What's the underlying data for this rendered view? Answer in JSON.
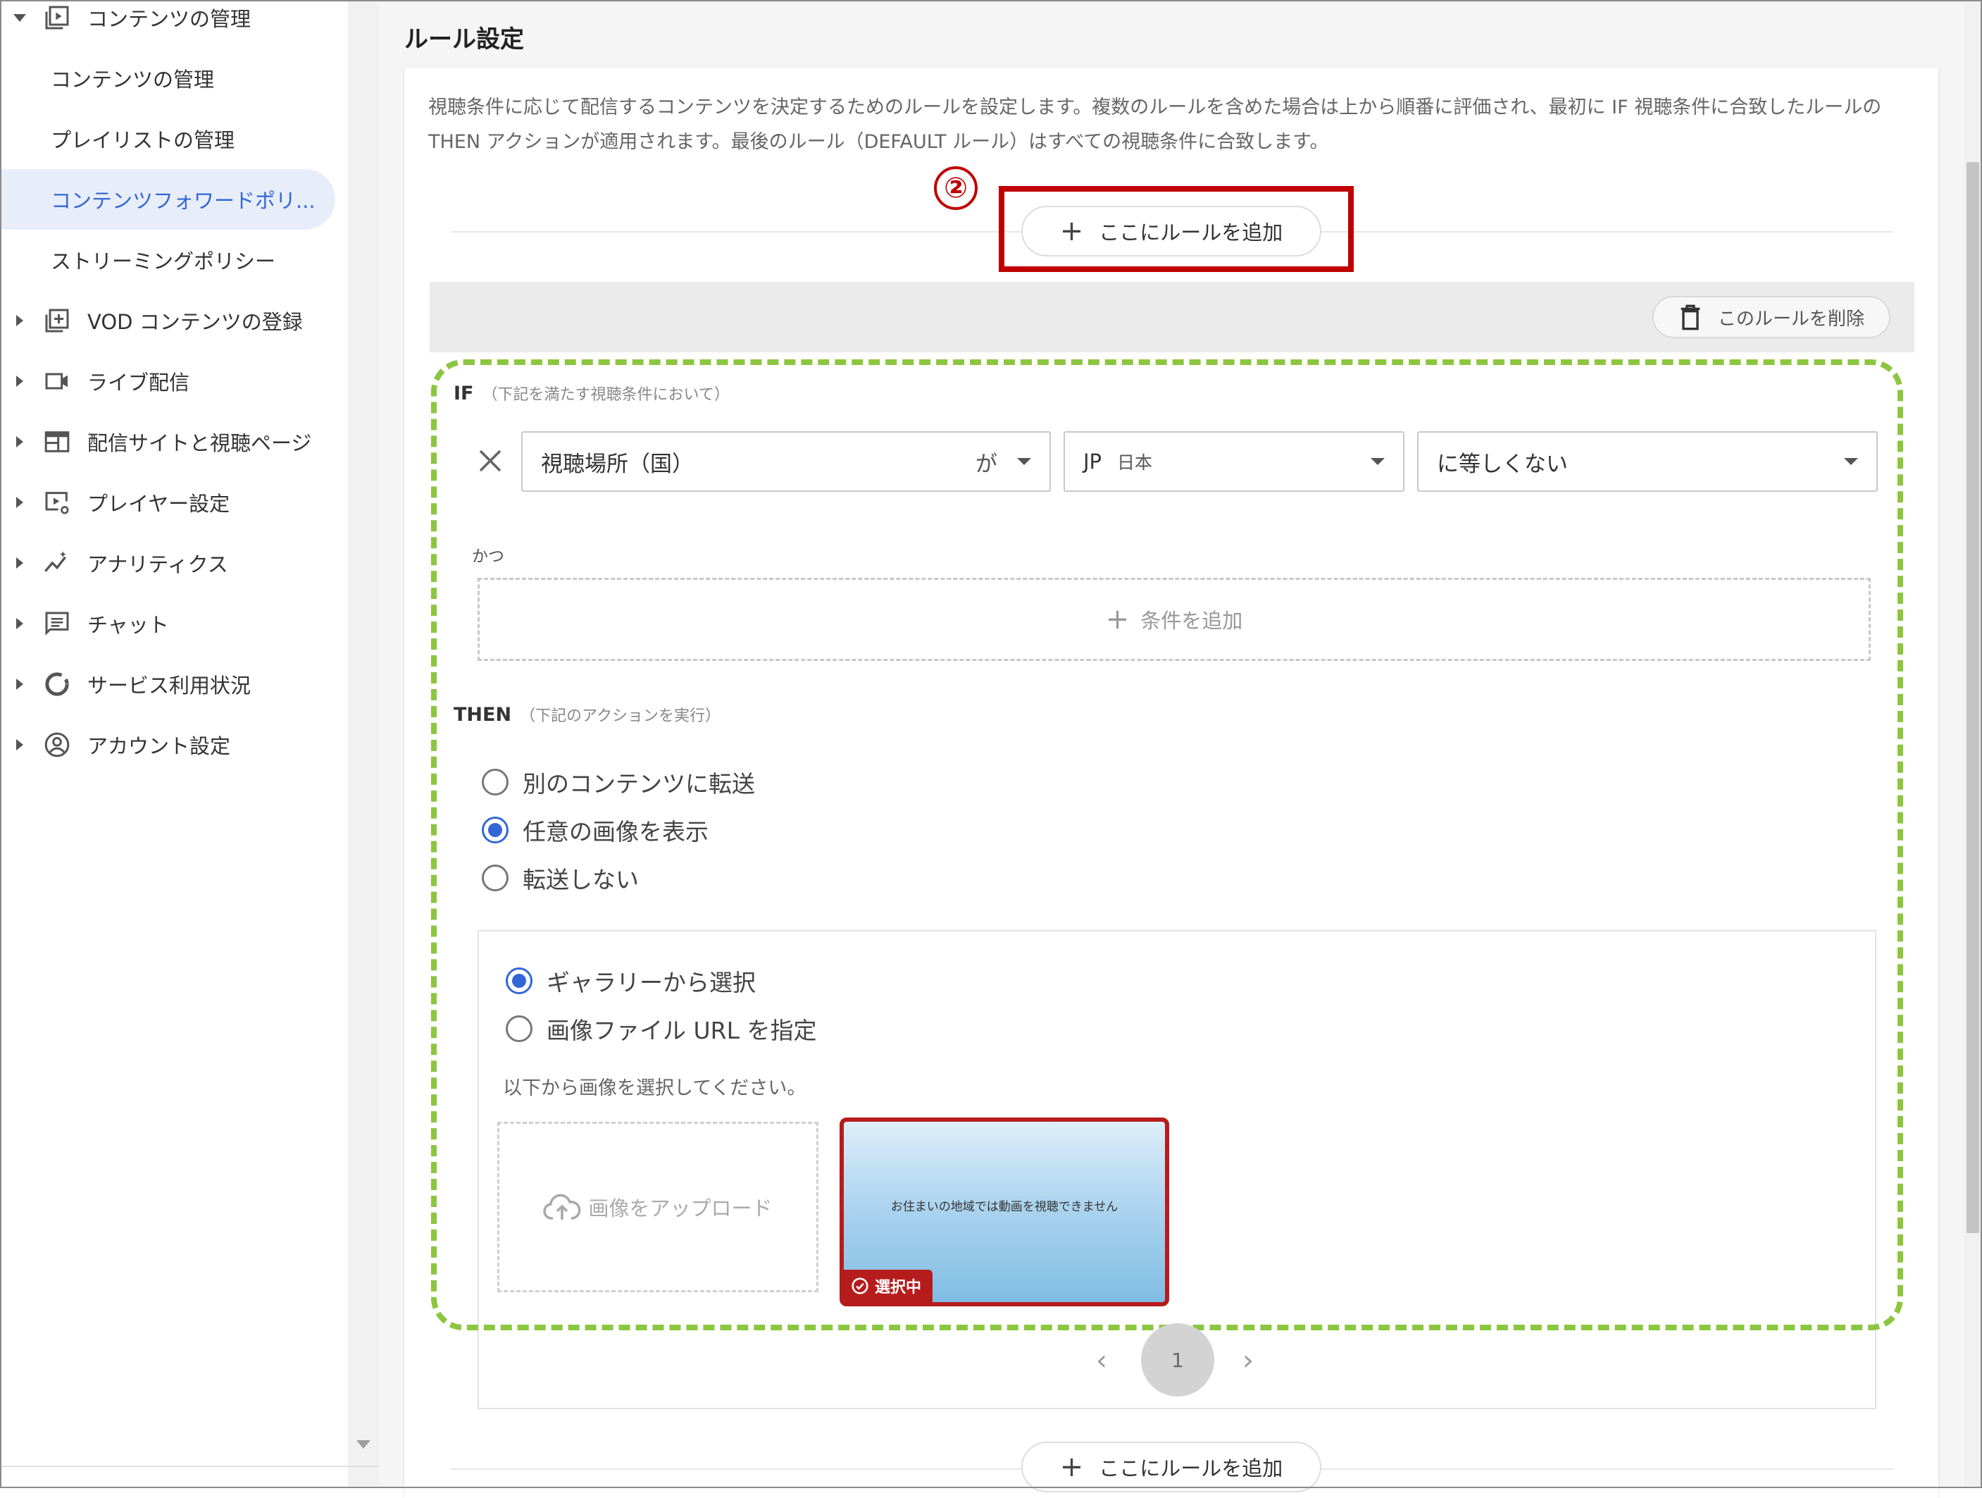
{
  "sidebar": {
    "content_mgmt_parent": "コンテンツの管理",
    "content_mgmt_sub": "コンテンツの管理",
    "playlist_mgmt": "プレイリストの管理",
    "forward_policy": "コンテンツフォワードポリ...",
    "streaming_policy": "ストリーミングポリシー",
    "vod_register": "VOD コンテンツの登録",
    "live": "ライブ配信",
    "sites": "配信サイトと視聴ページ",
    "player": "プレイヤー設定",
    "analytics": "アナリティクス",
    "chat": "チャット",
    "usage": "サービス利用状況",
    "account": "アカウント設定"
  },
  "main": {
    "section_title": "ルール設定",
    "description": "視聴条件に応じて配信するコンテンツを決定するためのルールを設定します。複数のルールを含めた場合は上から順番に評価され、最初に IF 視聴条件に合致したルールの THEN アクションが適用されます。最後のルール（DEFAULT ルール）はすべての視聴条件に合致します。",
    "add_rule_label": "ここにルールを追加",
    "delete_rule_label": "このルールを削除",
    "annotation_number": "②",
    "accent_color": "#3367d6",
    "highlight_color": "#c00000",
    "dashed_outline_color": "#8cc63f"
  },
  "rule": {
    "if_label": "IF",
    "if_hint": "（下記を満たす視聴条件において）",
    "condition": {
      "field": "視聴場所（国）",
      "particle": "が",
      "country_code": "JP",
      "country_name": "日本",
      "operator": "に等しくない"
    },
    "and_label": "かつ",
    "add_condition": "条件を追加",
    "then_label": "THEN",
    "then_hint": "（下記のアクションを実行）",
    "actions": [
      {
        "label": "別のコンテンツに転送",
        "selected": false
      },
      {
        "label": "任意の画像を表示",
        "selected": true
      },
      {
        "label": "転送しない",
        "selected": false
      }
    ],
    "image_sources": [
      {
        "label": "ギャラリーから選択",
        "selected": true
      },
      {
        "label": "画像ファイル URL を指定",
        "selected": false
      }
    ],
    "image_hint": "以下から画像を選択してください。",
    "upload_label": "画像をアップロード",
    "thumbnail_text": "お住まいの地域では動画を視聴できません",
    "selected_badge": "選択中",
    "page_number": "1"
  }
}
